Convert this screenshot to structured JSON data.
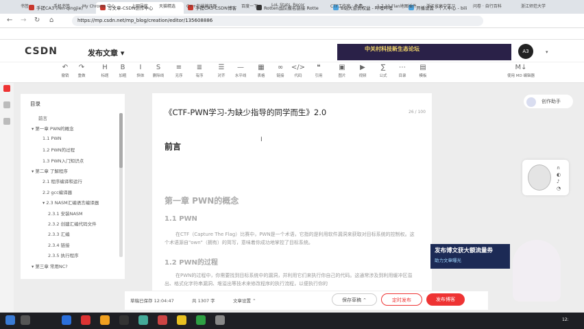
{
  "tabs": [
    {
      "label": "手搓CA3 (ren-qingjie)"
    },
    {
      "label": "写文章-CSDN创作中心"
    },
    {
      "label": "手搓CA3-CSDN博客"
    },
    {
      "label": "Rotten战队报名链接 Rotte"
    },
    {
      "label": "B站大会员权益 - 哔哩哔哩"
    },
    {
      "label": "开播设置 - 个人中心 - bili"
    }
  ],
  "address": {
    "url": "https://mp.csdn.net/mp_blog/creation/editor/135608886"
  },
  "bookmarks": [
    "书签",
    "手机书签",
    "My Chrome 中心",
    "上网导航",
    "天猫精选",
    "C++在线编译器",
    "百度一下",
    "LoL Stats, Recor",
    "CTF工作室 · 免费",
    "1.7.10 Flan地图插件",
    "浙江省高中学习",
    "问卷 · 自行百科",
    "浙江师范大学"
  ],
  "header": {
    "logo": "CSDN",
    "title": "发布文章",
    "ad_text": "中关村科技新生态论坛",
    "avatar_label": "A3"
  },
  "toolbar": [
    {
      "icon": "undo-icon",
      "glyph": "↶",
      "label": "撤销"
    },
    {
      "icon": "redo-icon",
      "glyph": "↷",
      "label": "重做"
    },
    {
      "icon": "heading-icon",
      "glyph": "H",
      "label": "标题"
    },
    {
      "icon": "bold-icon",
      "glyph": "B",
      "label": "加粗"
    },
    {
      "icon": "italic-icon",
      "glyph": "I",
      "label": "斜体"
    },
    {
      "icon": "strike-icon",
      "glyph": "S",
      "label": "删除线"
    },
    {
      "icon": "unordered-list-icon",
      "glyph": "≡",
      "label": "无序"
    },
    {
      "icon": "ordered-list-icon",
      "glyph": "≣",
      "label": "有序"
    },
    {
      "icon": "align-icon",
      "glyph": "☰",
      "label": "对齐"
    },
    {
      "icon": "hr-icon",
      "glyph": "—",
      "label": "水平线"
    },
    {
      "icon": "table-icon",
      "glyph": "▦",
      "label": "表格"
    },
    {
      "icon": "link-icon",
      "glyph": "∞",
      "label": "链接"
    },
    {
      "icon": "code-icon",
      "glyph": "</>",
      "label": "代码"
    },
    {
      "icon": "quote-icon",
      "glyph": "❝",
      "label": "引用"
    },
    {
      "icon": "image-icon",
      "glyph": "▣",
      "label": "图片"
    },
    {
      "icon": "video-icon",
      "glyph": "▶",
      "label": "视频"
    },
    {
      "icon": "formula-icon",
      "glyph": "∑",
      "label": "公式"
    },
    {
      "icon": "more-icon",
      "glyph": "⋯",
      "label": "目录"
    },
    {
      "icon": "template-icon",
      "glyph": "▤",
      "label": "模板"
    },
    {
      "icon": "markdown-icon",
      "glyph": "M↓",
      "label": "使用 MD 编辑器"
    }
  ],
  "toc": {
    "title": "目录",
    "items": [
      {
        "label": "前言",
        "level": 0
      },
      {
        "label": "▾ 第一章 PWN的概念",
        "level": 0
      },
      {
        "label": "1.1 PWN",
        "level": 1
      },
      {
        "label": "1.2 PWN的过程",
        "level": 1
      },
      {
        "label": "1.3 PWN入门知识点",
        "level": 1
      },
      {
        "label": "▾ 第二章 了解程序",
        "level": 0
      },
      {
        "label": "2.1 程序编译和运行",
        "level": 1
      },
      {
        "label": "2.2 gcc编译器",
        "level": 1
      },
      {
        "label": "▾ 2.3 NASM汇编语言编译器",
        "level": 1
      },
      {
        "label": "2.3.1 安装NASM",
        "level": 2
      },
      {
        "label": "2.3.2 创建汇编代码文件",
        "level": 2
      },
      {
        "label": "2.3.3 汇编",
        "level": 2
      },
      {
        "label": "2.3.4 链接",
        "level": 2
      },
      {
        "label": "2.3.5 执行程序",
        "level": 2
      },
      {
        "label": "▾ 第三章 常用NC?",
        "level": 0
      }
    ]
  },
  "editor": {
    "title": "《CTF-PWN学习-为缺少指导的同学而生》2.0",
    "title_count": "26 / 100",
    "preface": "前言",
    "chapter1": "第一章 PWN的概念",
    "sec11": "1.1 PWN",
    "para1": "在CTF（Capture The Flag）比赛中，PWN是一个术语，它指的是利用软件漏洞来获取对目标系统的控制权。这个术语源自\"own\"（拥有）的简写，意味着你成功地掌控了目标系统。",
    "sec12": "1.2 PWN的过程",
    "para2": "在PWN的过程中，你需要找到目标系统中的漏洞，并利用它们来执行你自己的代码。这通常涉及到利用缓冲区溢出、格式化字符串漏洞、堆溢出等技术来修改程序的执行流程，以便执行你的"
  },
  "side": {
    "helper": "创作助手",
    "promo_title": "发布博文获大额流量券",
    "promo_sub": "助力文章曝光"
  },
  "status": {
    "saved": "草稿已保存 12:04:47",
    "words": "共 1307 字",
    "settings": "文章设置 ⌃"
  },
  "actions": {
    "save_draft": "保存草稿 ⌃",
    "schedule": "定时发布",
    "publish": "发布博客"
  },
  "taskbar": {
    "time": "12:"
  }
}
